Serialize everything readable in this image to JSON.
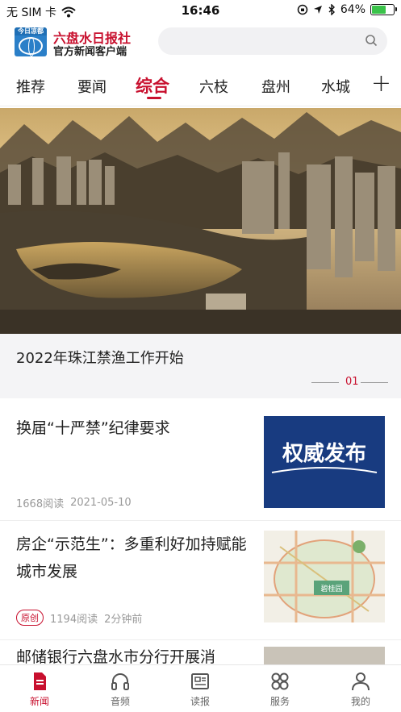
{
  "status_bar": {
    "carrier": "无 SIM 卡",
    "time": "16:46",
    "battery": "64%",
    "battery_level": 0.64
  },
  "header": {
    "logo_text": "今日凉都",
    "brand_name": "六盘水日报社",
    "brand_sub": "官方新闻客户端"
  },
  "search": {
    "placeholder": ""
  },
  "tabs": [
    {
      "label": "推荐"
    },
    {
      "label": "要闻"
    },
    {
      "label": "综合"
    },
    {
      "label": "六枝"
    },
    {
      "label": "盘州"
    },
    {
      "label": "水城"
    }
  ],
  "active_tab": "综合",
  "add_tab_label": "+",
  "banner": {
    "title": "2022年珠江禁渔工作开始",
    "index": "01"
  },
  "news": [
    {
      "title": "换届“十严禁”纪律要求",
      "badge": "",
      "reads": "1668阅读",
      "time": "2021-05-10",
      "thumb_text": "权威发布"
    },
    {
      "title": "房企“示范生”：多重利好加持赋能城市发展",
      "badge": "原创",
      "reads": "1194阅读",
      "time": "2分钟前",
      "thumb_text": "碧桂园"
    },
    {
      "title": "邮储银行六盘水市分行开展消",
      "badge": "",
      "reads": "",
      "time": "",
      "thumb_text": ""
    }
  ],
  "bottom_nav": [
    {
      "label": "新闻",
      "icon": "news-icon"
    },
    {
      "label": "音频",
      "icon": "headphones-icon"
    },
    {
      "label": "读报",
      "icon": "newspaper-icon"
    },
    {
      "label": "服务",
      "icon": "grid-icon"
    },
    {
      "label": "我的",
      "icon": "profile-icon"
    }
  ],
  "colors": {
    "accent": "#c8102e",
    "tab_text": "#222222",
    "meta": "#999999"
  }
}
